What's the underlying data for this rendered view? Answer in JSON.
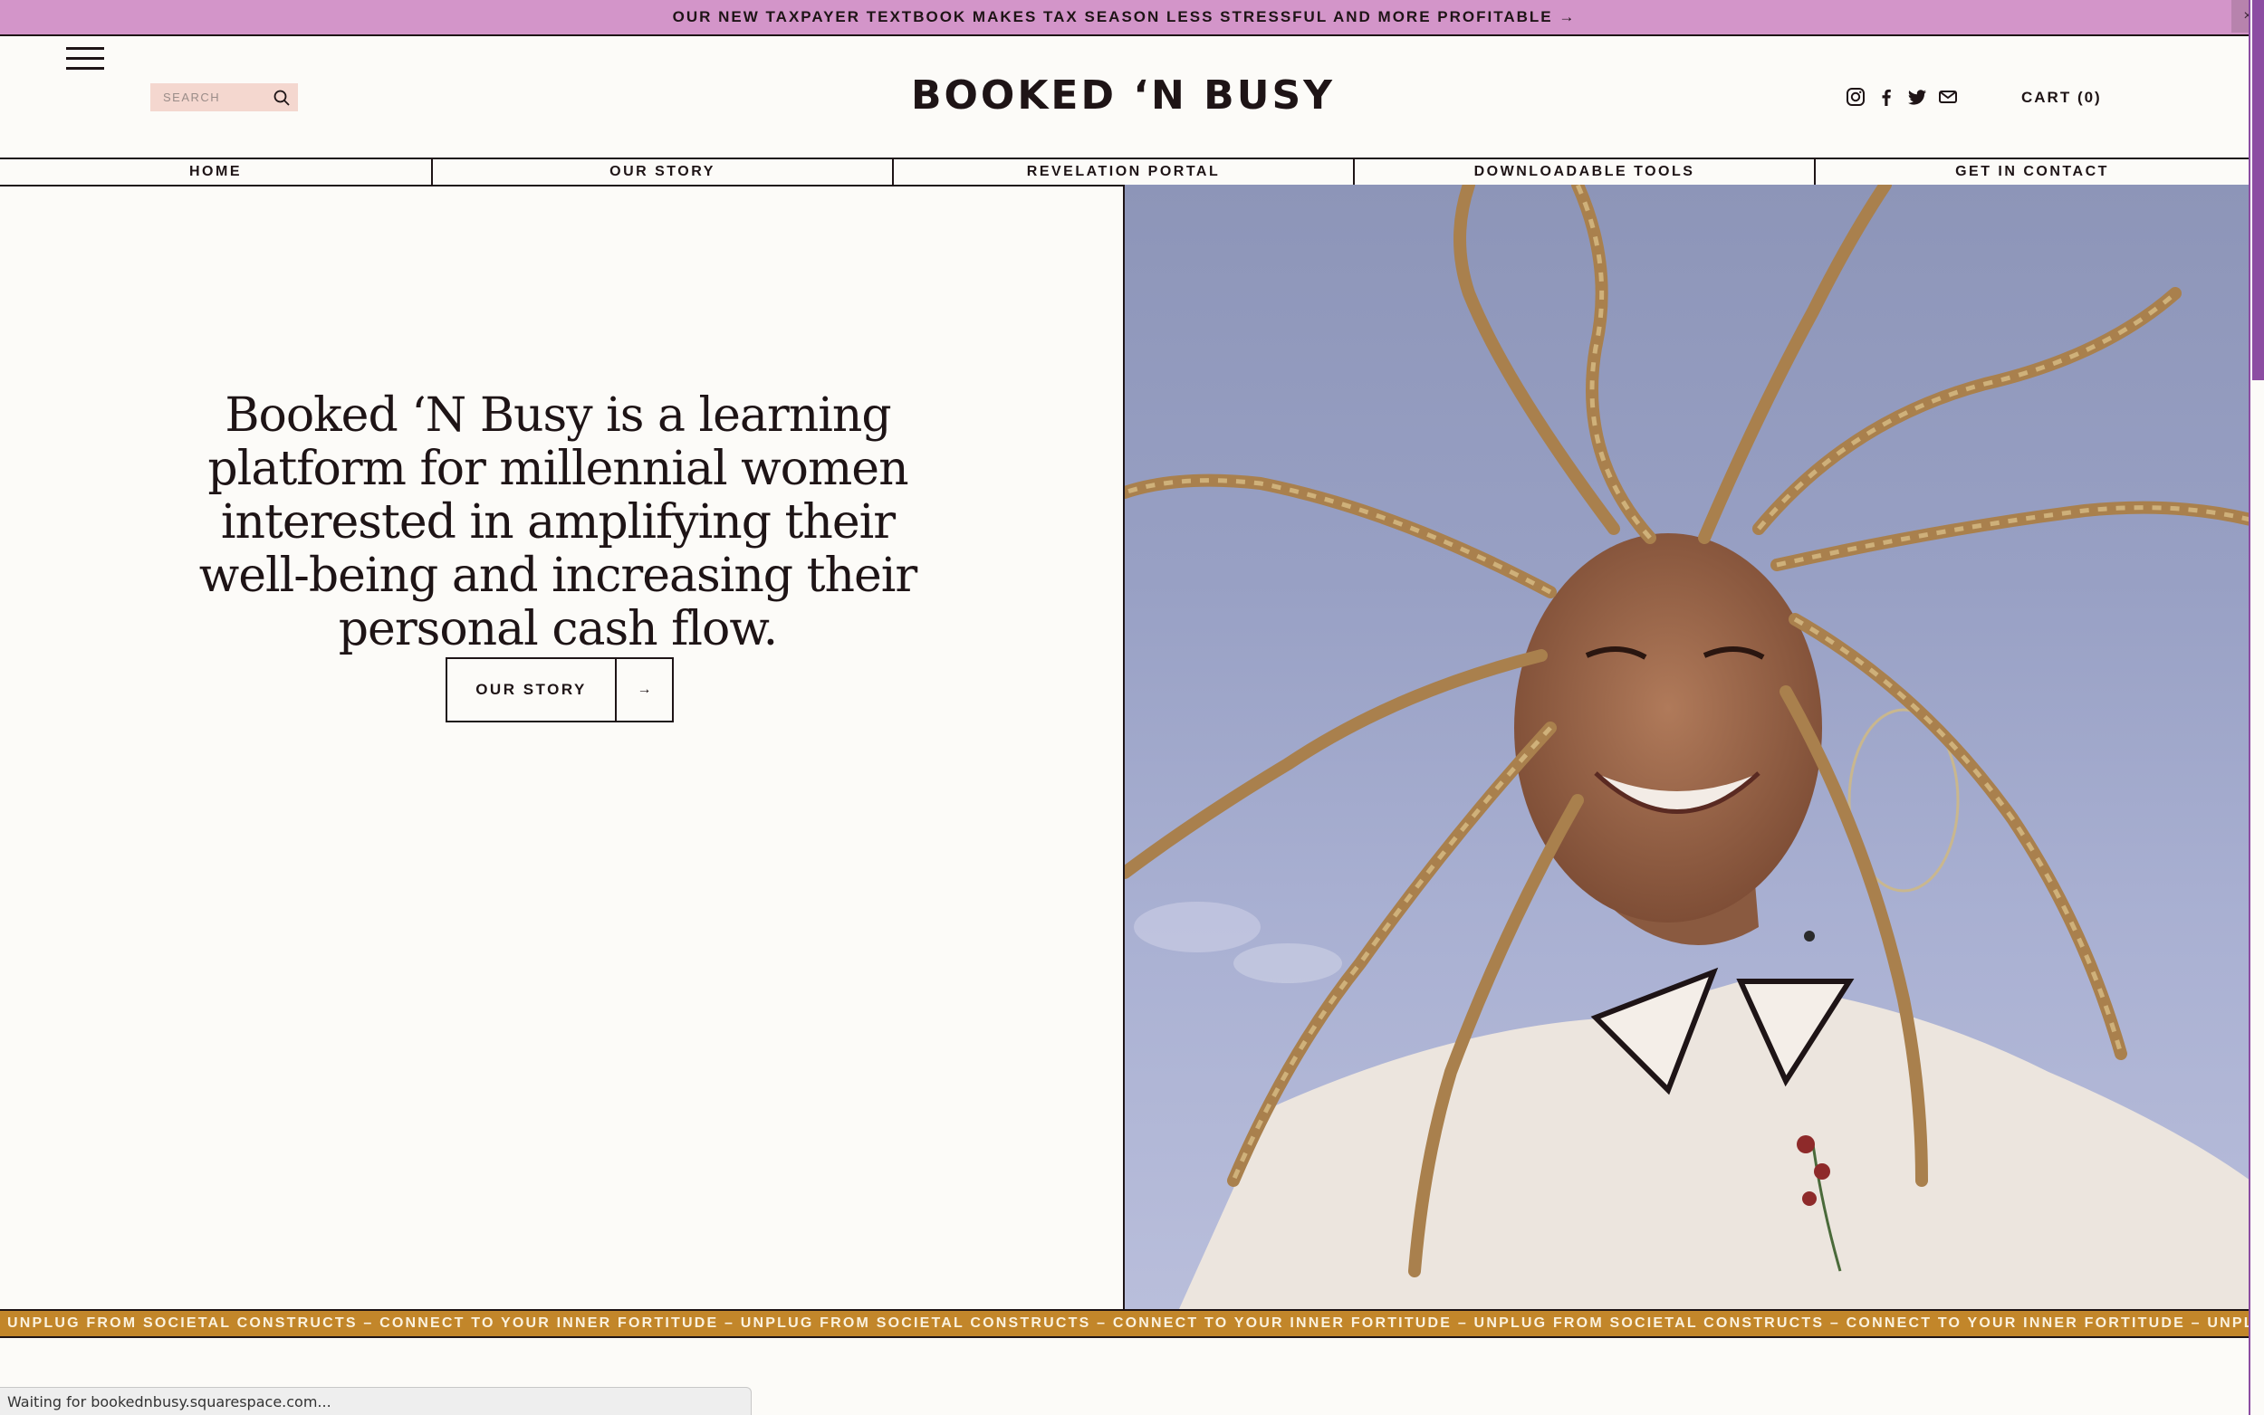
{
  "announcement": {
    "text": "OUR NEW TAXPAYER TEXTBOOK MAKES TAX SEASON LESS STRESSFUL AND MORE PROFITABLE →",
    "close_label": "×"
  },
  "header": {
    "search_placeholder": "SEARCH",
    "brand": "BOOKED ‘N BUSY",
    "cart_label": "CART (0)",
    "social_icons": [
      "instagram-icon",
      "facebook-icon",
      "twitter-icon",
      "mail-icon"
    ]
  },
  "nav": {
    "items": [
      {
        "label": "HOME"
      },
      {
        "label": "OUR STORY"
      },
      {
        "label": "REVELATION PORTAL"
      },
      {
        "label": "DOWNLOADABLE TOOLS"
      },
      {
        "label": "GET IN CONTACT"
      }
    ]
  },
  "hero": {
    "headline": "Booked ‘N Busy is a learning platform for millennial women interested in amplifying their well-being and increasing their personal cash flow.",
    "cta_label": "OUR STORY",
    "cta_arrow": "→"
  },
  "ticker": {
    "text": "UNPLUG FROM SOCIETAL CONSTRUCTS – CONNECT TO YOUR INNER FORTITUDE – UNPLUG FROM SOCIETAL CONSTRUCTS – CONNECT TO YOUR INNER FORTITUDE – UNPLUG FROM SOCIETAL CONSTRUCTS – CONNECT TO YOUR INNER FORTITUDE – UNPLUG"
  },
  "browser": {
    "status_text": "Waiting for bookednbusy.squarespace.com..."
  },
  "colors": {
    "announcement_bg": "#d395c9",
    "ink": "#1e1416",
    "page_bg": "#fcfbf8",
    "search_bg": "#f4d7cf",
    "ticker_bg": "#c2862a",
    "ticker_text": "#fbf2df",
    "scroll_accent": "#8c4da2"
  }
}
